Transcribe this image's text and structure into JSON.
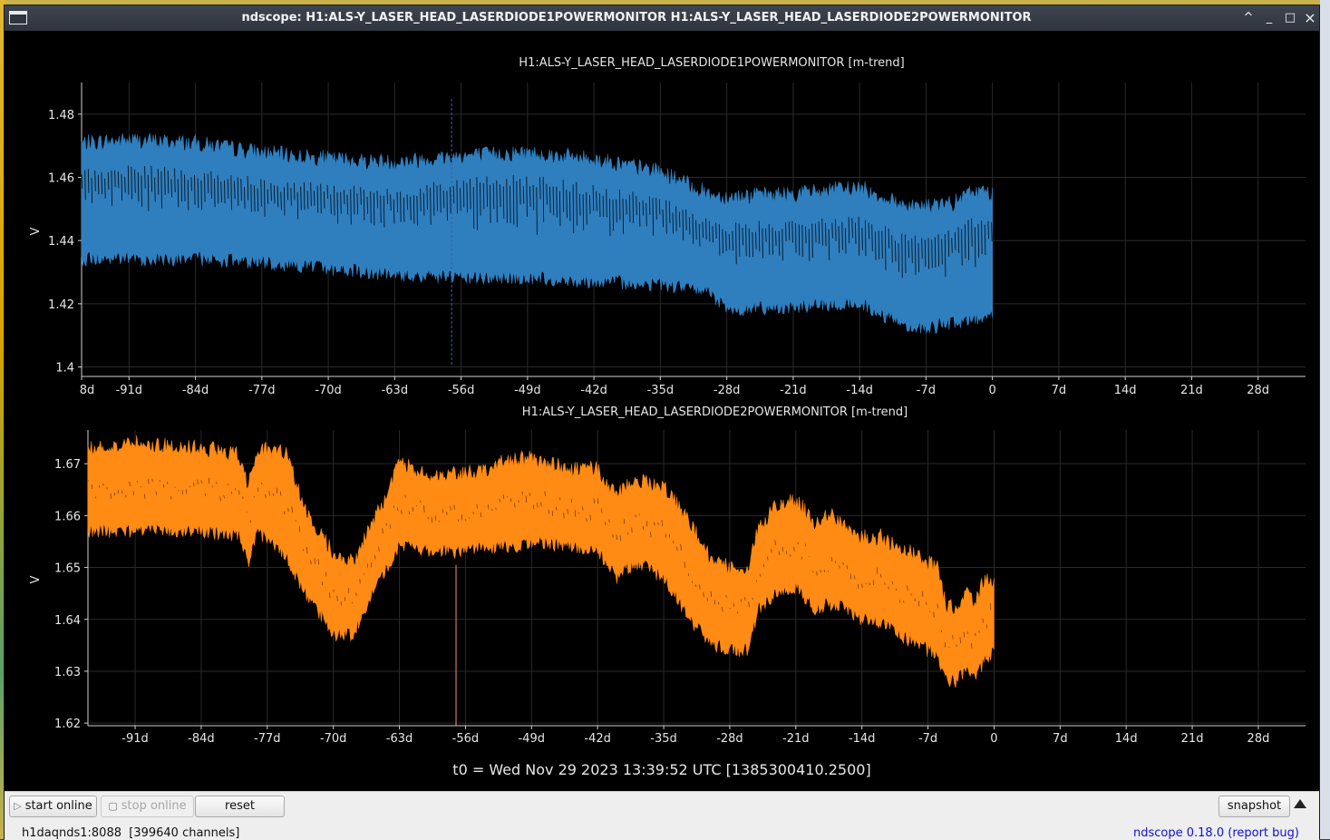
{
  "window": {
    "title": "ndscope: H1:ALS-Y_LASER_HEAD_LASERDIODE1POWERMONITOR H1:ALS-Y_LASER_HEAD_LASERDIODE2POWERMONITOR",
    "controls": {
      "minimize": "^",
      "shade": "_",
      "maximize": "□",
      "close": "×"
    }
  },
  "t0_label": "t0 = Wed Nov 29 2023 13:39:52 UTC [1385300410.2500]",
  "toolbar": {
    "start_online": "start online",
    "stop_online": "stop online",
    "reset": "reset",
    "snapshot": "snapshot"
  },
  "status": {
    "server": "h1daqnds1:8088  [399640 channels]",
    "version": "ndscope 0.18.0",
    "report_bug": "report bug"
  },
  "chart_data": [
    {
      "type": "line",
      "title": "H1:ALS-Y_LASER_HEAD_LASERDIODE1POWERMONITOR [m-trend]",
      "ylabel": "V",
      "color": "#2f7fbf",
      "xlim": [
        -96,
        33
      ],
      "ylim": [
        1.397,
        1.49
      ],
      "x_ticks": [
        {
          "v": -98,
          "label": "8d"
        },
        {
          "v": -91,
          "label": "-91d"
        },
        {
          "v": -84,
          "label": "-84d"
        },
        {
          "v": -77,
          "label": "-77d"
        },
        {
          "v": -70,
          "label": "-70d"
        },
        {
          "v": -63,
          "label": "-63d"
        },
        {
          "v": -56,
          "label": "-56d"
        },
        {
          "v": -49,
          "label": "-49d"
        },
        {
          "v": -42,
          "label": "-42d"
        },
        {
          "v": -35,
          "label": "-35d"
        },
        {
          "v": -28,
          "label": "-28d"
        },
        {
          "v": -21,
          "label": "-21d"
        },
        {
          "v": -14,
          "label": "-14d"
        },
        {
          "v": -7,
          "label": "-7d"
        },
        {
          "v": 0,
          "label": "0"
        },
        {
          "v": 7,
          "label": "7d"
        },
        {
          "v": 14,
          "label": "14d"
        },
        {
          "v": 21,
          "label": "21d"
        },
        {
          "v": 28,
          "label": "28d"
        }
      ],
      "y_ticks": [
        {
          "v": 1.4,
          "label": "1.4"
        },
        {
          "v": 1.42,
          "label": "1.42"
        },
        {
          "v": 1.44,
          "label": "1.44"
        },
        {
          "v": 1.46,
          "label": "1.46"
        },
        {
          "v": 1.48,
          "label": "1.48"
        }
      ],
      "cursor_x": -57,
      "envelope": {
        "x": [
          -96,
          -91,
          -84,
          -77,
          -70,
          -63,
          -56,
          -49,
          -42,
          -35,
          -30,
          -28,
          -21,
          -14,
          -10,
          -7,
          -4,
          -2,
          0
        ],
        "max": [
          1.471,
          1.472,
          1.471,
          1.468,
          1.466,
          1.465,
          1.467,
          1.468,
          1.466,
          1.462,
          1.455,
          1.454,
          1.455,
          1.457,
          1.452,
          1.451,
          1.452,
          1.456,
          1.455
        ],
        "min": [
          1.434,
          1.434,
          1.434,
          1.433,
          1.431,
          1.429,
          1.428,
          1.428,
          1.427,
          1.426,
          1.424,
          1.418,
          1.419,
          1.42,
          1.414,
          1.412,
          1.414,
          1.415,
          1.416
        ],
        "upper_band": [
          1.461,
          1.462,
          1.461,
          1.458,
          1.456,
          1.455,
          1.458,
          1.459,
          1.456,
          1.452,
          1.445,
          1.444,
          1.445,
          1.446,
          1.441,
          1.44,
          1.442,
          1.446,
          1.445
        ],
        "lower_band": [
          1.444,
          1.444,
          1.444,
          1.443,
          1.44,
          1.438,
          1.437,
          1.437,
          1.436,
          1.436,
          1.433,
          1.427,
          1.428,
          1.429,
          1.423,
          1.421,
          1.423,
          1.424,
          1.425
        ]
      }
    },
    {
      "type": "line",
      "title": "H1:ALS-Y_LASER_HEAD_LASERDIODE2POWERMONITOR [m-trend]",
      "ylabel": "V",
      "color": "#ff8a14",
      "xlim": [
        -96,
        33
      ],
      "ylim": [
        1.6195,
        1.6765
      ],
      "x_ticks": [
        {
          "v": -91,
          "label": "-91d"
        },
        {
          "v": -84,
          "label": "-84d"
        },
        {
          "v": -77,
          "label": "-77d"
        },
        {
          "v": -70,
          "label": "-70d"
        },
        {
          "v": -63,
          "label": "-63d"
        },
        {
          "v": -56,
          "label": "-56d"
        },
        {
          "v": -49,
          "label": "-49d"
        },
        {
          "v": -42,
          "label": "-42d"
        },
        {
          "v": -35,
          "label": "-35d"
        },
        {
          "v": -28,
          "label": "-28d"
        },
        {
          "v": -21,
          "label": "-21d"
        },
        {
          "v": -14,
          "label": "-14d"
        },
        {
          "v": -7,
          "label": "-7d"
        },
        {
          "v": 0,
          "label": "0"
        },
        {
          "v": 7,
          "label": "7d"
        },
        {
          "v": 14,
          "label": "14d"
        },
        {
          "v": 21,
          "label": "21d"
        },
        {
          "v": 28,
          "label": "28d"
        }
      ],
      "y_ticks": [
        {
          "v": 1.62,
          "label": "1.62"
        },
        {
          "v": 1.63,
          "label": "1.63"
        },
        {
          "v": 1.64,
          "label": "1.64"
        },
        {
          "v": 1.65,
          "label": "1.65"
        },
        {
          "v": 1.66,
          "label": "1.66"
        },
        {
          "v": 1.67,
          "label": "1.67"
        }
      ],
      "cursor_x": -57,
      "cursor_color": "#ff8a7a",
      "envelope": {
        "x": [
          -96,
          -91,
          -84,
          -80,
          -79,
          -78,
          -77,
          -75,
          -73,
          -71,
          -70,
          -68,
          -66,
          -64,
          -63,
          -60,
          -57,
          -54,
          -51,
          -49,
          -45,
          -42,
          -40,
          -38,
          -35,
          -33,
          -31,
          -30,
          -28,
          -26,
          -25,
          -23,
          -21,
          -19,
          -17,
          -14,
          -12,
          -10,
          -8,
          -6,
          -5,
          -4,
          -3,
          -2,
          -1,
          0
        ],
        "max": [
          1.673,
          1.674,
          1.673,
          1.672,
          1.666,
          1.673,
          1.673,
          1.672,
          1.661,
          1.656,
          1.653,
          1.651,
          1.658,
          1.666,
          1.67,
          1.668,
          1.668,
          1.669,
          1.671,
          1.671,
          1.669,
          1.669,
          1.664,
          1.667,
          1.666,
          1.661,
          1.655,
          1.652,
          1.65,
          1.65,
          1.658,
          1.662,
          1.663,
          1.659,
          1.66,
          1.656,
          1.656,
          1.654,
          1.652,
          1.65,
          1.642,
          1.643,
          1.645,
          1.643,
          1.648,
          1.648
        ],
        "min": [
          1.657,
          1.657,
          1.657,
          1.656,
          1.65,
          1.657,
          1.655,
          1.652,
          1.645,
          1.64,
          1.637,
          1.637,
          1.644,
          1.651,
          1.654,
          1.653,
          1.653,
          1.654,
          1.654,
          1.655,
          1.654,
          1.653,
          1.648,
          1.651,
          1.648,
          1.642,
          1.637,
          1.635,
          1.634,
          1.634,
          1.642,
          1.645,
          1.646,
          1.642,
          1.643,
          1.64,
          1.639,
          1.637,
          1.635,
          1.633,
          1.628,
          1.628,
          1.63,
          1.628,
          1.632,
          1.634
        ]
      }
    }
  ]
}
